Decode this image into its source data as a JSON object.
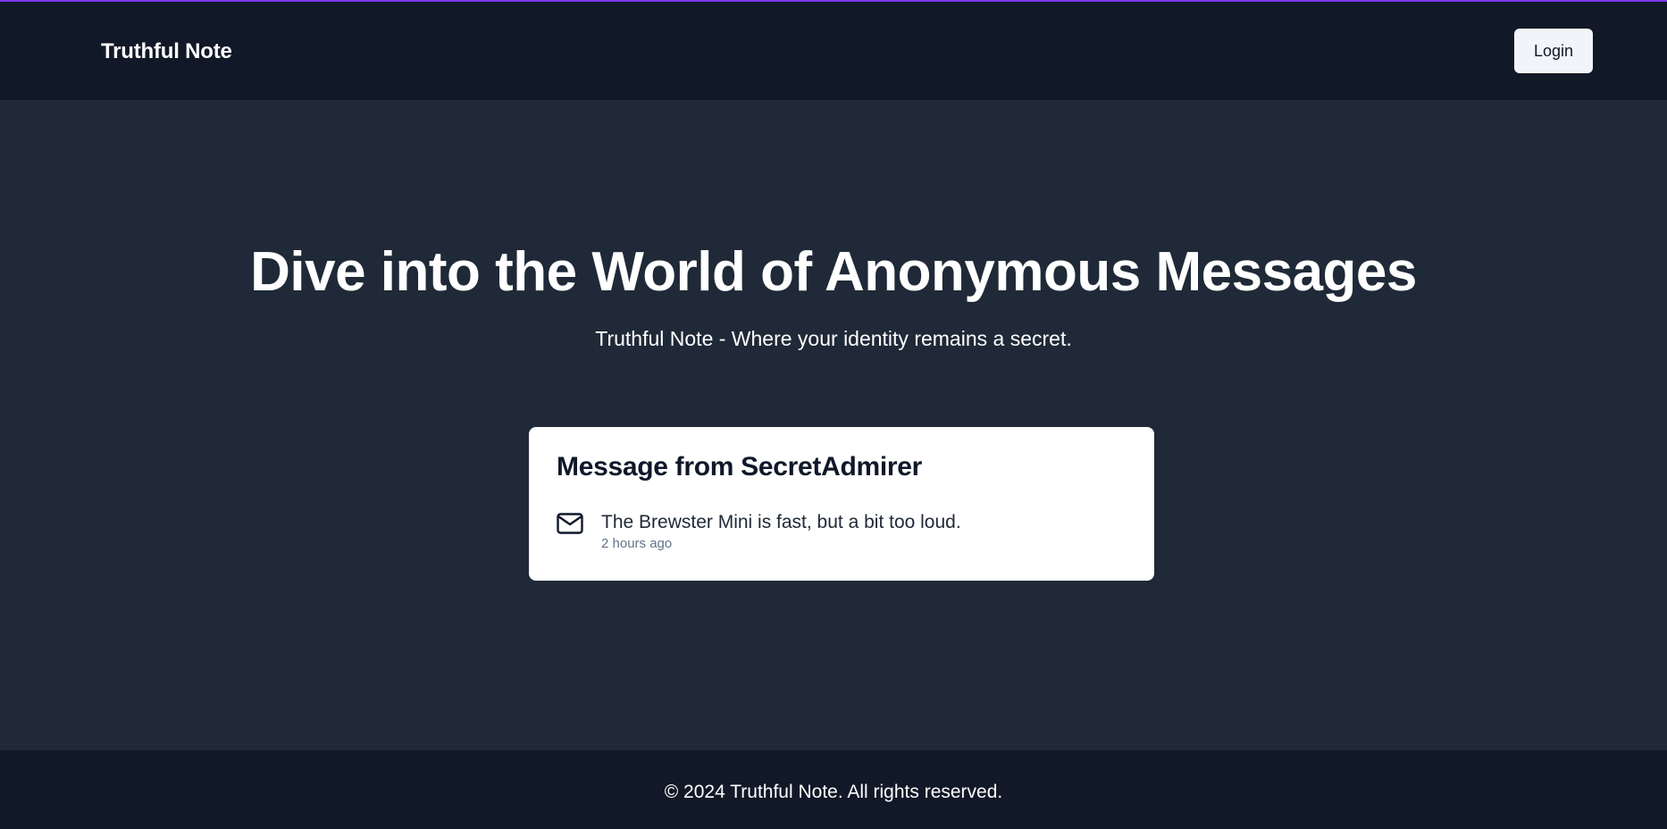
{
  "colors": {
    "accent": "#7c3aed",
    "header_bg": "#111827",
    "main_bg": "#1f2937",
    "card_bg": "#ffffff",
    "button_bg": "#f1f5f9"
  },
  "header": {
    "brand": "Truthful Note",
    "login_label": "Login"
  },
  "hero": {
    "title": "Dive into the World of Anonymous Messages",
    "subtitle": "Truthful Note - Where your identity remains a secret."
  },
  "message_card": {
    "title": "Message from SecretAdmirer",
    "icon": "mail-icon",
    "content": "The Brewster Mini is fast, but a bit too loud.",
    "time": "2 hours ago"
  },
  "footer": {
    "copyright": "© 2024 Truthful Note. All rights reserved."
  }
}
